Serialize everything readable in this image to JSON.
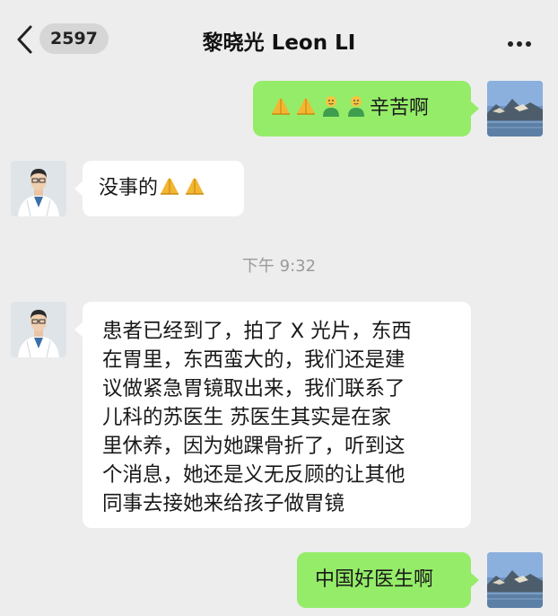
{
  "header": {
    "back_icon": "chevron-left-icon",
    "unread_count": "2597",
    "title": "黎晓光 Leon LI",
    "more_icon": "more-dots-icon"
  },
  "messages": [
    {
      "side": "right",
      "emojis": [
        "bowing-hands-emoji",
        "bowing-hands-emoji",
        "person-emoji",
        "person-emoji"
      ],
      "text": "辛苦啊"
    },
    {
      "side": "left",
      "text": "没事的",
      "emojis": [
        "bowing-hands-emoji",
        "bowing-hands-emoji"
      ]
    },
    {
      "side": "right",
      "text": "中国好医生啊"
    }
  ],
  "timestamp": "下午 9:32",
  "long_message": {
    "lines": [
      "患者已经到了，拍了 X 光片，东西",
      "在胃里，东西蛮大的，我们还是建",
      "议做紧急胃镜取出来，我们联系了",
      "儿科的苏医生 苏医生其实是在家",
      "里休养，因为她踝骨折了，听到这",
      "个消息，她还是义无反顾的让其他",
      "同事去接她来给孩子做胃镜"
    ]
  },
  "colors": {
    "background": "#ededed",
    "my_bubble": "#95ec69",
    "their_bubble": "#ffffff",
    "timestamp_text": "#9a9a9a"
  }
}
